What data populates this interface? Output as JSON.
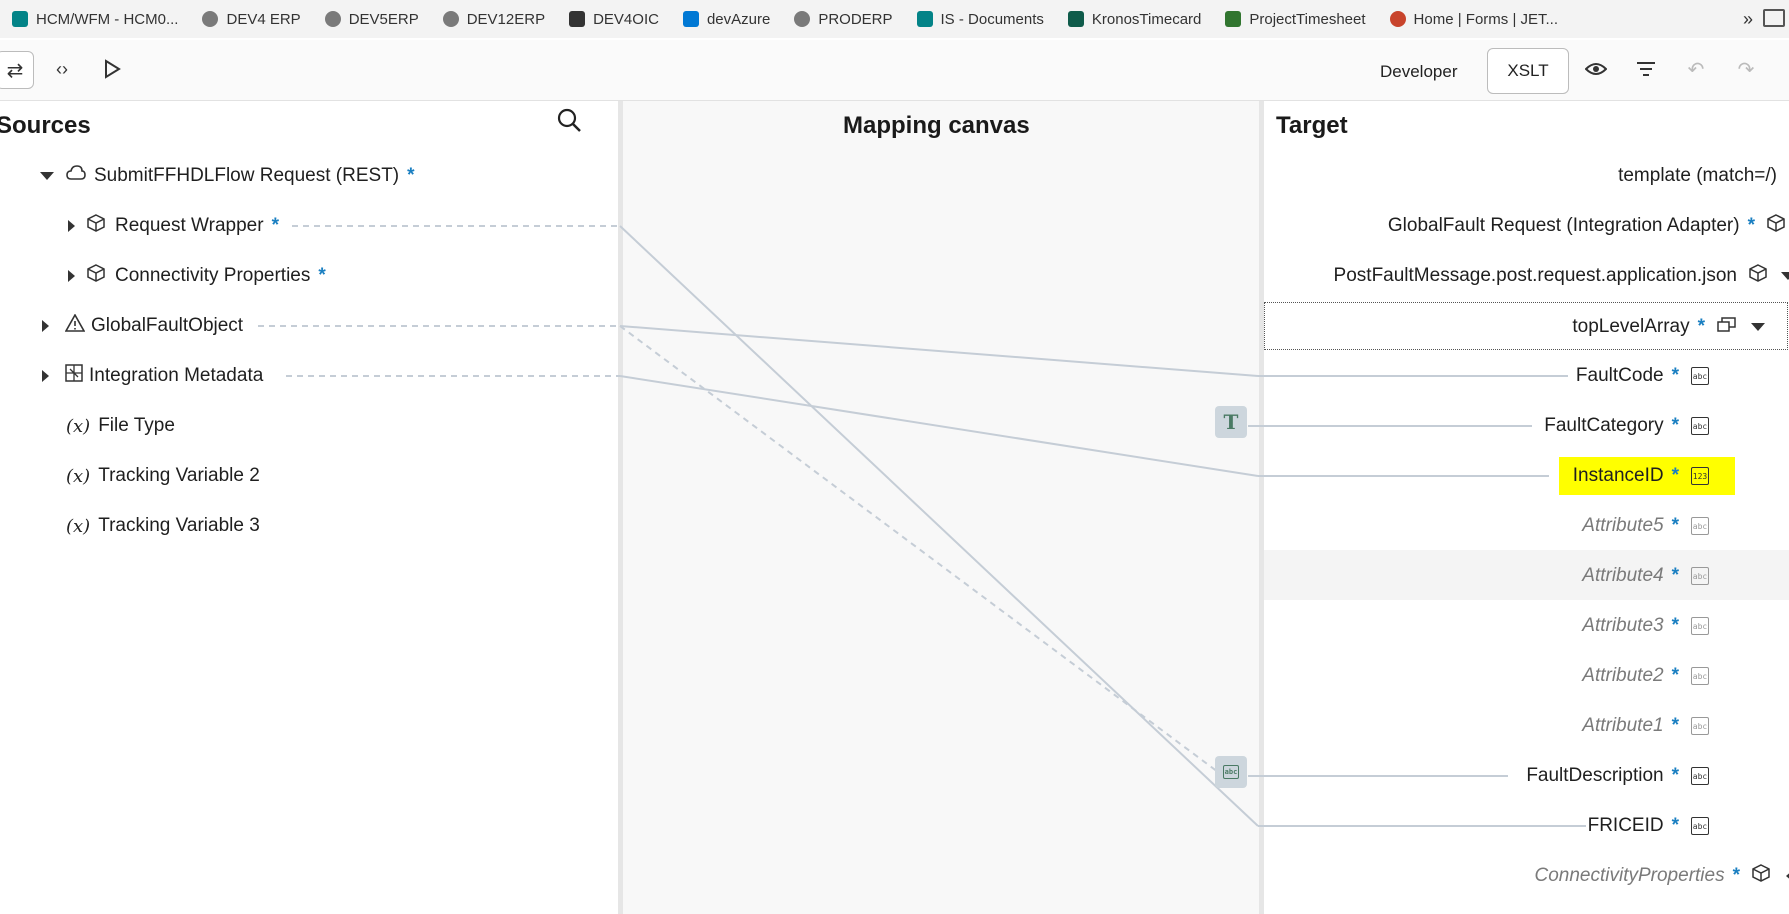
{
  "bookmarks": [
    {
      "label": "HCM/WFM - HCM0...",
      "icon": "sharepoint-icon",
      "color": "#038387"
    },
    {
      "label": "DEV4 ERP",
      "icon": "globe-icon",
      "color": "#757575"
    },
    {
      "label": "DEV5ERP",
      "icon": "globe-icon",
      "color": "#757575"
    },
    {
      "label": "DEV12ERP",
      "icon": "globe-icon",
      "color": "#757575"
    },
    {
      "label": "DEV4OIC",
      "icon": "oic-icon",
      "color": "#333333"
    },
    {
      "label": "devAzure",
      "icon": "azure-devops-icon",
      "color": "#0078d4"
    },
    {
      "label": "PRODERP",
      "icon": "globe-icon",
      "color": "#757575"
    },
    {
      "label": "IS - Documents",
      "icon": "sharepoint-icon",
      "color": "#038387"
    },
    {
      "label": "KronosTimecard",
      "icon": "kronos-icon",
      "color": "#0f5b4a"
    },
    {
      "label": "ProjectTimesheet",
      "icon": "project-icon",
      "color": "#31752f"
    },
    {
      "label": "Home | Forms | JET...",
      "icon": "forms-icon",
      "color": "#c8432b"
    }
  ],
  "toolbar": {
    "mode": "Developer",
    "xslt": "XSLT"
  },
  "sources": {
    "title": "Sources",
    "items": [
      {
        "label": "SubmitFFHDLFlow Request (REST)",
        "required": "*",
        "icon": "rest-cloud-icon",
        "expanded": true
      },
      {
        "label": "Request Wrapper",
        "required": "*",
        "icon": "cube-icon"
      },
      {
        "label": "Connectivity Properties",
        "required": "*",
        "icon": "cube-icon"
      },
      {
        "label": "GlobalFaultObject",
        "icon": "warning-icon"
      },
      {
        "label": "Integration Metadata",
        "icon": "metadata-icon"
      },
      {
        "label": "File Type",
        "icon": "variable-icon"
      },
      {
        "label": "Tracking Variable 2",
        "icon": "variable-icon"
      },
      {
        "label": "Tracking Variable 3",
        "icon": "variable-icon"
      }
    ],
    "var_symbol": "(x)"
  },
  "canvas": {
    "title": "Mapping canvas",
    "fn_t": "T",
    "fn_abc": "abc"
  },
  "target": {
    "title": "Target",
    "items": [
      {
        "label": "template (match=/)"
      },
      {
        "label": "GlobalFault Request (Integration Adapter)",
        "required": "*",
        "icon": "cube-icon"
      },
      {
        "label": "PostFaultMessage.post.request.application.json",
        "icon": "cube-icon"
      },
      {
        "label": "topLevelArray",
        "required": "*",
        "icon": "array-icon"
      },
      {
        "label": "FaultCode",
        "required": "*",
        "icon": "string-icon"
      },
      {
        "label": "FaultCategory",
        "required": "*",
        "icon": "string-icon"
      },
      {
        "label": "InstanceID",
        "required": "*",
        "icon": "number-icon",
        "highlighted": true
      },
      {
        "label": "Attribute5",
        "required": "*",
        "icon": "string-icon",
        "unmapped": true
      },
      {
        "label": "Attribute4",
        "required": "*",
        "icon": "string-icon",
        "unmapped": true
      },
      {
        "label": "Attribute3",
        "required": "*",
        "icon": "string-icon",
        "unmapped": true
      },
      {
        "label": "Attribute2",
        "required": "*",
        "icon": "string-icon",
        "unmapped": true
      },
      {
        "label": "Attribute1",
        "required": "*",
        "icon": "string-icon",
        "unmapped": true
      },
      {
        "label": "FaultDescription",
        "required": "*",
        "icon": "string-icon"
      },
      {
        "label": "FRICEID",
        "required": "*",
        "icon": "string-icon"
      },
      {
        "label": "ConnectivityProperties",
        "required": "*",
        "icon": "cube-icon",
        "unmapped": true
      }
    ],
    "abc": "abc",
    "num": "123"
  },
  "colors": {
    "required": "#1a7fc1",
    "highlight": "#ffff00",
    "link": "#c5cdd6"
  }
}
